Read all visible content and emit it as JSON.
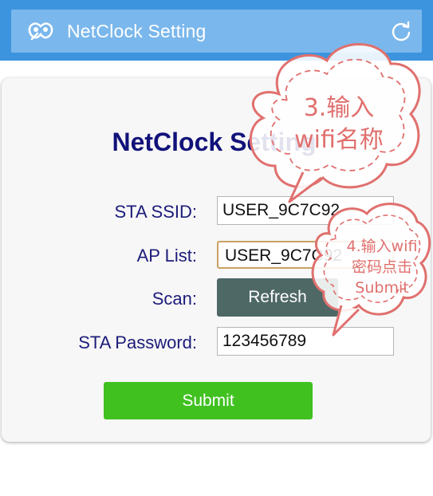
{
  "appbar": {
    "title": "NetClock Setting",
    "logo_icon": "mask-logo-icon",
    "refresh_icon": "refresh-icon"
  },
  "form": {
    "heading": "NetClock Setting",
    "sta_ssid_label": "STA SSID:",
    "sta_ssid_value": "USER_9C7C92",
    "ap_list_label": "AP List:",
    "ap_list_selected": "USER_9C7C92",
    "scan_label": "Scan:",
    "refresh_button": "Refresh",
    "sta_password_label": "STA Password:",
    "sta_password_value": "123456789",
    "submit_button": "Submit"
  },
  "annotations": {
    "step3_line1": "3.输入",
    "step3_line2": "wifi名称",
    "step4_line1": "4.输入wifi",
    "step4_line2": "密码点击",
    "step4_line3": "Submit"
  },
  "colors": {
    "appbar": "#3d94de",
    "appbar_inner": "#7ab7ec",
    "heading": "#12127a",
    "refresh_button": "#4e6866",
    "submit_button": "#40c120",
    "annotation": "#e0706e"
  }
}
